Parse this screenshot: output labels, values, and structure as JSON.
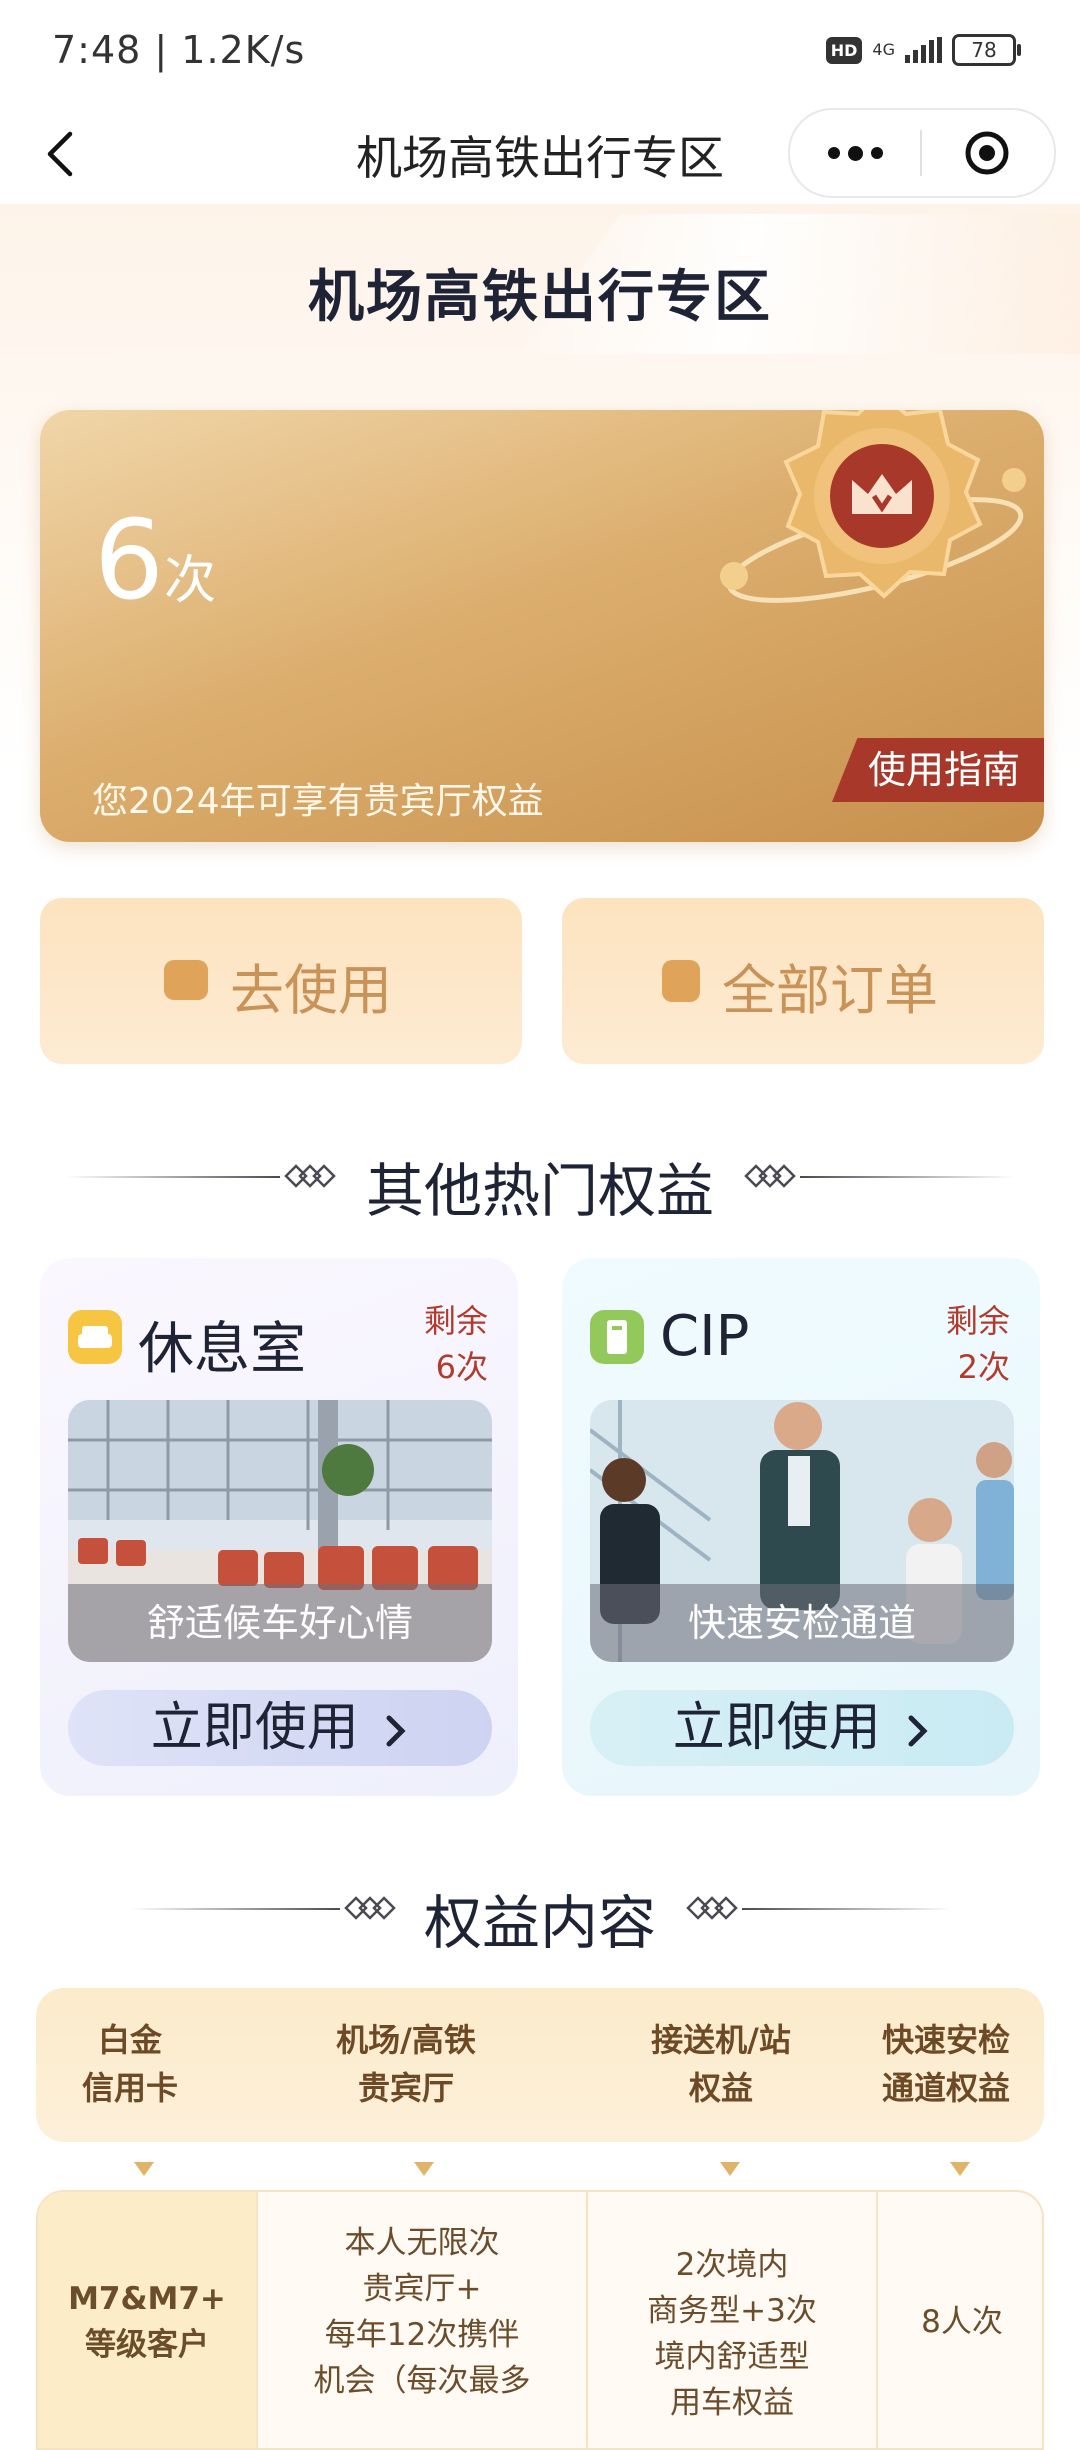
{
  "status": {
    "time_speed": "7:48 | 1.2K/s",
    "net": "4G",
    "battery": "78"
  },
  "nav": {
    "title": "机场高铁出行专区"
  },
  "zone_title": "机场高铁出行专区",
  "hero": {
    "count": "6",
    "unit": "次",
    "desc": "您2024年可享有贵宾厅权益",
    "guide": "使用指南"
  },
  "actions": {
    "use_label": "去使用",
    "orders_label": "全部订单"
  },
  "section_hot": "其他热门权益",
  "benefits": [
    {
      "name": "休息室",
      "remain_label": "剩余",
      "remain_count": "6次",
      "caption": "舒适候车好心情",
      "button": "立即使用"
    },
    {
      "name": "CIP",
      "remain_label": "剩余",
      "remain_count": "2次",
      "caption": "快速安检通道",
      "button": "立即使用"
    }
  ],
  "section_rights": "权益内容",
  "table": {
    "headers": [
      "白金\n信用卡",
      "机场/高铁\n贵宾厅",
      "接送机/站\n权益",
      "快速安检\n通道权益"
    ],
    "row": [
      "M7&M7+\n等级客户",
      "本人无限次\n贵宾厅+\n每年12次携伴\n机会（每次最多",
      "2次境内\n商务型+3次\n境内舒适型\n用车权益",
      "8人次"
    ]
  },
  "colors": {
    "accent": "#c99257",
    "remain": "#b13c2e",
    "guide_bg": "#a8392a",
    "title": "#1f2336"
  },
  "icons": [
    "back-icon",
    "more-dots-icon",
    "record-target-icon",
    "ticket-icon",
    "order-list-icon",
    "sofa-icon",
    "cip-card-icon",
    "chevron-right-icon",
    "crown-medal-icon",
    "diamond-ornament-icon"
  ]
}
